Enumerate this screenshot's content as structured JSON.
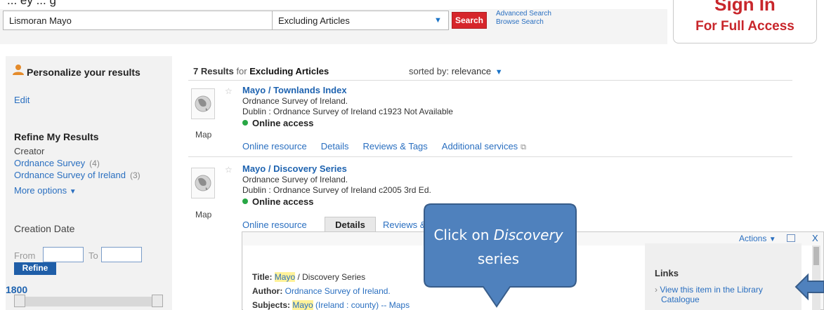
{
  "top_caption": "... ey ... g",
  "search": {
    "value": "Lismoran Mayo",
    "scope": "Excluding Articles",
    "button": "Search",
    "advanced_link": "Advanced Search",
    "browse_link": "Browse Search"
  },
  "signin": {
    "line1": "Sign In",
    "line2": "For Full Access"
  },
  "sidebar": {
    "personalize": "Personalize your results",
    "edit": "Edit",
    "refine_heading": "Refine My Results",
    "creator_label": "Creator",
    "creators": [
      {
        "name": "Ordnance Survey",
        "count": "(4)"
      },
      {
        "name": "Ordnance Survey of Ireland",
        "count": "(3)"
      }
    ],
    "more_options": "More options",
    "creation_date": "Creation Date",
    "from_label": "From",
    "to_label": "To",
    "refine_button": "Refine",
    "date_value": "1800"
  },
  "results": {
    "count": "7 Results",
    "for": "for",
    "query": "Excluding Articles",
    "sorted_by_label": "sorted by:",
    "sorted_by_value": "relevance",
    "items": [
      {
        "title": "Mayo / Townlands Index",
        "author": "Ordnance Survey of Ireland.",
        "publication": "Dublin : Ordnance Survey of Ireland c1923 Not Available",
        "availability": "Online access",
        "type": "Map",
        "tabs": [
          "Online resource",
          "Details",
          "Reviews & Tags",
          "Additional services"
        ]
      },
      {
        "title": "Mayo / Discovery Series",
        "author": "Ordnance Survey of Ireland.",
        "publication": "Dublin : Ordnance Survey of Ireland c2005 3rd Ed.",
        "availability": "Online access",
        "type": "Map",
        "tabs": [
          "Online resource",
          "Details",
          "Reviews &"
        ]
      }
    ]
  },
  "details": {
    "actions": "Actions",
    "close": "X",
    "title_label": "Title:",
    "title_hl": "Mayo",
    "title_rest": " / Discovery Series",
    "author_label": "Author:",
    "author_value": "Ordnance Survey of Ireland.",
    "subjects_label": "Subjects:",
    "subjects_hl": "Mayo",
    "subjects_rest": " (Ireland : county) -- Maps",
    "links_heading": "Links",
    "link1_line1": "View this item in the Library",
    "link1_line2": "Catalogue"
  },
  "callout": {
    "prefix": "Click on ",
    "italic": "Discovery",
    "suffix": "series"
  },
  "colors": {
    "accent_red": "#c8262b",
    "link_blue": "#2a6fc0",
    "callout_blue": "#4f81bd"
  }
}
